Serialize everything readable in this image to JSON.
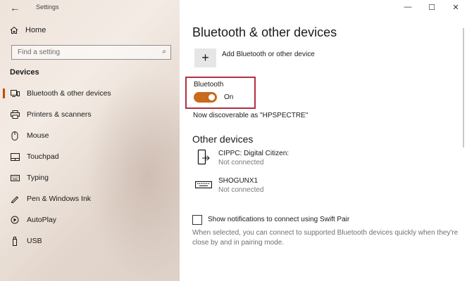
{
  "titlebar": {
    "back_glyph": "←",
    "app_title": "Settings"
  },
  "window_controls": {
    "minimize": "—",
    "maximize": "☐",
    "close": "✕"
  },
  "sidebar": {
    "home_label": "Home",
    "search_placeholder": "Find a setting",
    "section_label": "Devices",
    "items": [
      {
        "label": "Bluetooth & other devices",
        "icon": "bluetooth-devices-icon",
        "active": true
      },
      {
        "label": "Printers & scanners",
        "icon": "printer-icon",
        "active": false
      },
      {
        "label": "Mouse",
        "icon": "mouse-icon",
        "active": false
      },
      {
        "label": "Touchpad",
        "icon": "touchpad-icon",
        "active": false
      },
      {
        "label": "Typing",
        "icon": "keyboard-icon",
        "active": false
      },
      {
        "label": "Pen & Windows Ink",
        "icon": "pen-icon",
        "active": false
      },
      {
        "label": "AutoPlay",
        "icon": "autoplay-icon",
        "active": false
      },
      {
        "label": "USB",
        "icon": "usb-icon",
        "active": false
      }
    ]
  },
  "main": {
    "title": "Bluetooth & other devices",
    "add_device_label": "Add Bluetooth or other device",
    "bluetooth": {
      "label": "Bluetooth",
      "state": "On"
    },
    "discoverable_text": "Now discoverable as \"HPSPECTRE\"",
    "other_devices_heading": "Other devices",
    "devices": [
      {
        "name": "CIPPC: Digital Citizen:",
        "status": "Not connected",
        "icon": "phone-device-icon"
      },
      {
        "name": "SHOGUNX1",
        "status": "Not connected",
        "icon": "keyboard-device-icon"
      }
    ],
    "swift_pair": {
      "label": "Show notifications to connect using Swift Pair",
      "description": "When selected, you can connect to supported Bluetooth devices quickly when they're close by and in pairing mode."
    }
  },
  "colors": {
    "accent": "#c96a1e",
    "highlight_box": "#b0303f",
    "active_indicator": "#c04b00"
  }
}
